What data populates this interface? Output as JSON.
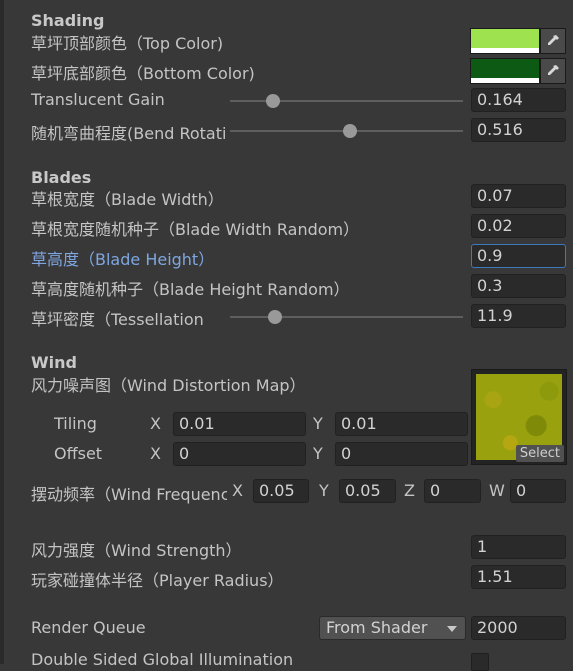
{
  "sections": {
    "shading": "Shading",
    "blades": "Blades",
    "wind": "Wind"
  },
  "shading": {
    "top_color_label": "草坪顶部颜色（Top Color)",
    "bottom_color_label": "草坪底部颜色（Bottom Color)",
    "top_color": "#9fe24f",
    "bottom_color": "#0c5a14",
    "translucent_label": "Translucent Gain",
    "translucent_value": "0.164",
    "translucent_fraction": 0.164,
    "bend_label": "随机弯曲程度(Bend Rotation Random)",
    "bend_value": "0.516",
    "bend_fraction": 0.516
  },
  "blades": {
    "width_label": "草根宽度（Blade Width）",
    "width_value": "0.07",
    "width_random_label": "草根宽度随机种子（Blade Width Random）",
    "width_random_value": "0.02",
    "height_label": "草高度（Blade Height）",
    "height_value": "0.9",
    "height_random_label": "草高度随机种子（Blade Height Random）",
    "height_random_value": "0.3",
    "tess_label": "草坪密度（Tessellation",
    "tess_value": "11.9",
    "tess_fraction": 0.21
  },
  "wind": {
    "map_label": "风力噪声图（Wind Distortion Map）",
    "tiling_label": "Tiling",
    "offset_label": "Offset",
    "axis_x": "X",
    "axis_y": "Y",
    "axis_z": "Z",
    "axis_w": "W",
    "tiling_x": "0.01",
    "tiling_y": "0.01",
    "offset_x": "0",
    "offset_y": "0",
    "select_label": "Select",
    "freq_label": "摆动频率（Wind Frequency）",
    "freq_x": "0.05",
    "freq_y": "0.05",
    "freq_z": "0",
    "freq_w": "0",
    "strength_label": "风力强度（Wind Strength）",
    "strength_value": "1",
    "radius_label": "玩家碰撞体半径（Player Radius）",
    "radius_value": "1.51"
  },
  "render": {
    "queue_label": "Render Queue",
    "queue_option": "From Shader",
    "queue_value": "2000",
    "gi_label": "Double Sided Global Illumination"
  }
}
